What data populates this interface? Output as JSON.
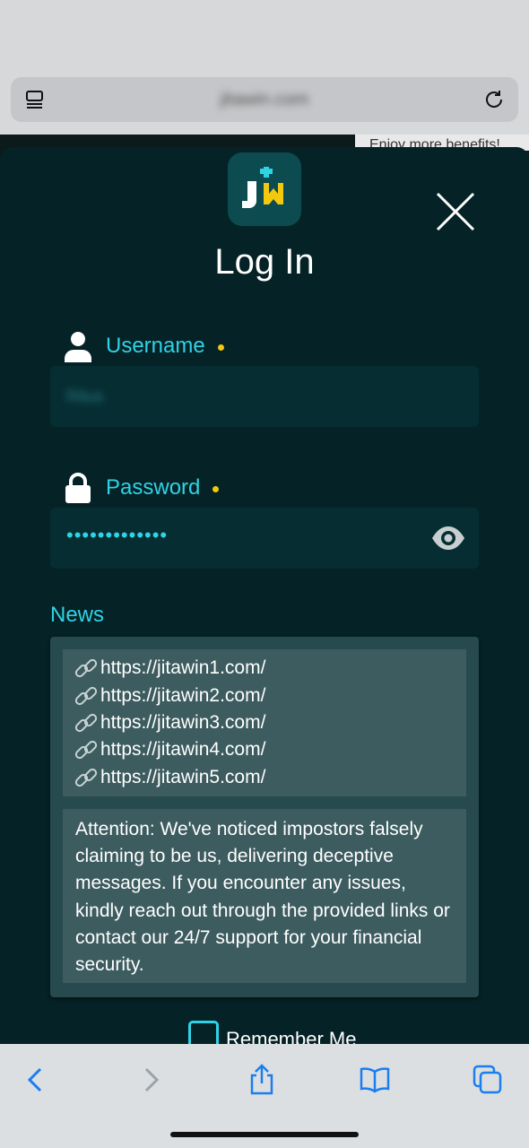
{
  "browser": {
    "url": "jitawin.com",
    "icons": {
      "tabs": "tab-list-icon",
      "reload": "reload-icon"
    }
  },
  "background_page": {
    "banner_text": "Enjoy more benefits!"
  },
  "login": {
    "logo_text": "JW",
    "title": "Log In",
    "username": {
      "label": "Username",
      "value": "Ritus"
    },
    "password": {
      "label": "Password",
      "masked_value": "•••••••••••••"
    },
    "news": {
      "label": "News",
      "links": [
        "https://jitawin1.com/",
        "https://jitawin2.com/",
        "https://jitawin3.com/",
        "https://jitawin4.com/",
        "https://jitawin5.com/"
      ],
      "notice": "Attention: We've noticed impostors falsely claiming to be us, delivering deceptive messages. If you encounter any issues, kindly reach out through the provided links or contact our 24/7 support for your financial security."
    },
    "remember_me": "Remember Me"
  },
  "colors": {
    "modal_bg": "#052226",
    "accent_cyan": "#2fd3e6",
    "required_dot": "#f2c90f",
    "input_bg": "#062e32",
    "news_panel": "#3d5c5f"
  }
}
